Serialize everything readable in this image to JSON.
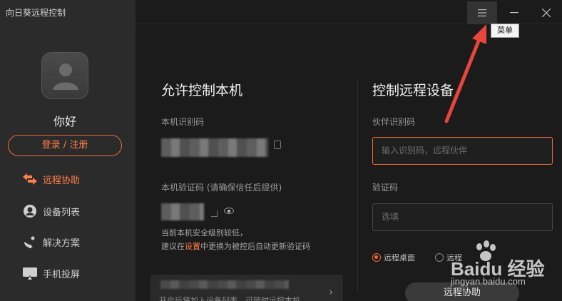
{
  "app": {
    "title": "向日葵远程控制"
  },
  "user": {
    "greeting": "你好",
    "login_label": "登录 / 注册"
  },
  "sidebar": {
    "items": [
      {
        "label": "远程协助",
        "icon": "remote-assist-icon",
        "active": true
      },
      {
        "label": "设备列表",
        "icon": "device-list-icon"
      },
      {
        "label": "解决方案",
        "icon": "solution-icon"
      },
      {
        "label": "手机投屏",
        "icon": "screen-cast-icon"
      }
    ]
  },
  "window": {
    "menu_tooltip": "菜单"
  },
  "allow": {
    "title": "允许控制本机",
    "id_label": "本机识别码",
    "code_label": "本机验证码 (请确保信任后提供)",
    "security_note_1": "当前本机安全级别较低，",
    "security_note_2_prefix": "建议在",
    "security_note_2_link": "设置",
    "security_note_2_suffix": "中更换为被控后自动更新验证码",
    "card_text": "开启后将加入设备列表，可随时远控本机"
  },
  "control": {
    "title": "控制远程设备",
    "partner_label": "伙伴识别码",
    "partner_placeholder": "输入识别码，远程伙伴",
    "code_label": "验证码",
    "code_placeholder": "选填",
    "radio_desktop": "远程桌面",
    "radio_other": "远程",
    "connect_label": "远程协助"
  },
  "watermark": {
    "brand": "Baidu 经验",
    "url": "jingyan.baidu.com"
  },
  "colors": {
    "accent": "#f06a35",
    "sidebar_bg": "#2b2b2b",
    "main_bg": "#1b1b1b",
    "arrow": "#e8453c"
  }
}
